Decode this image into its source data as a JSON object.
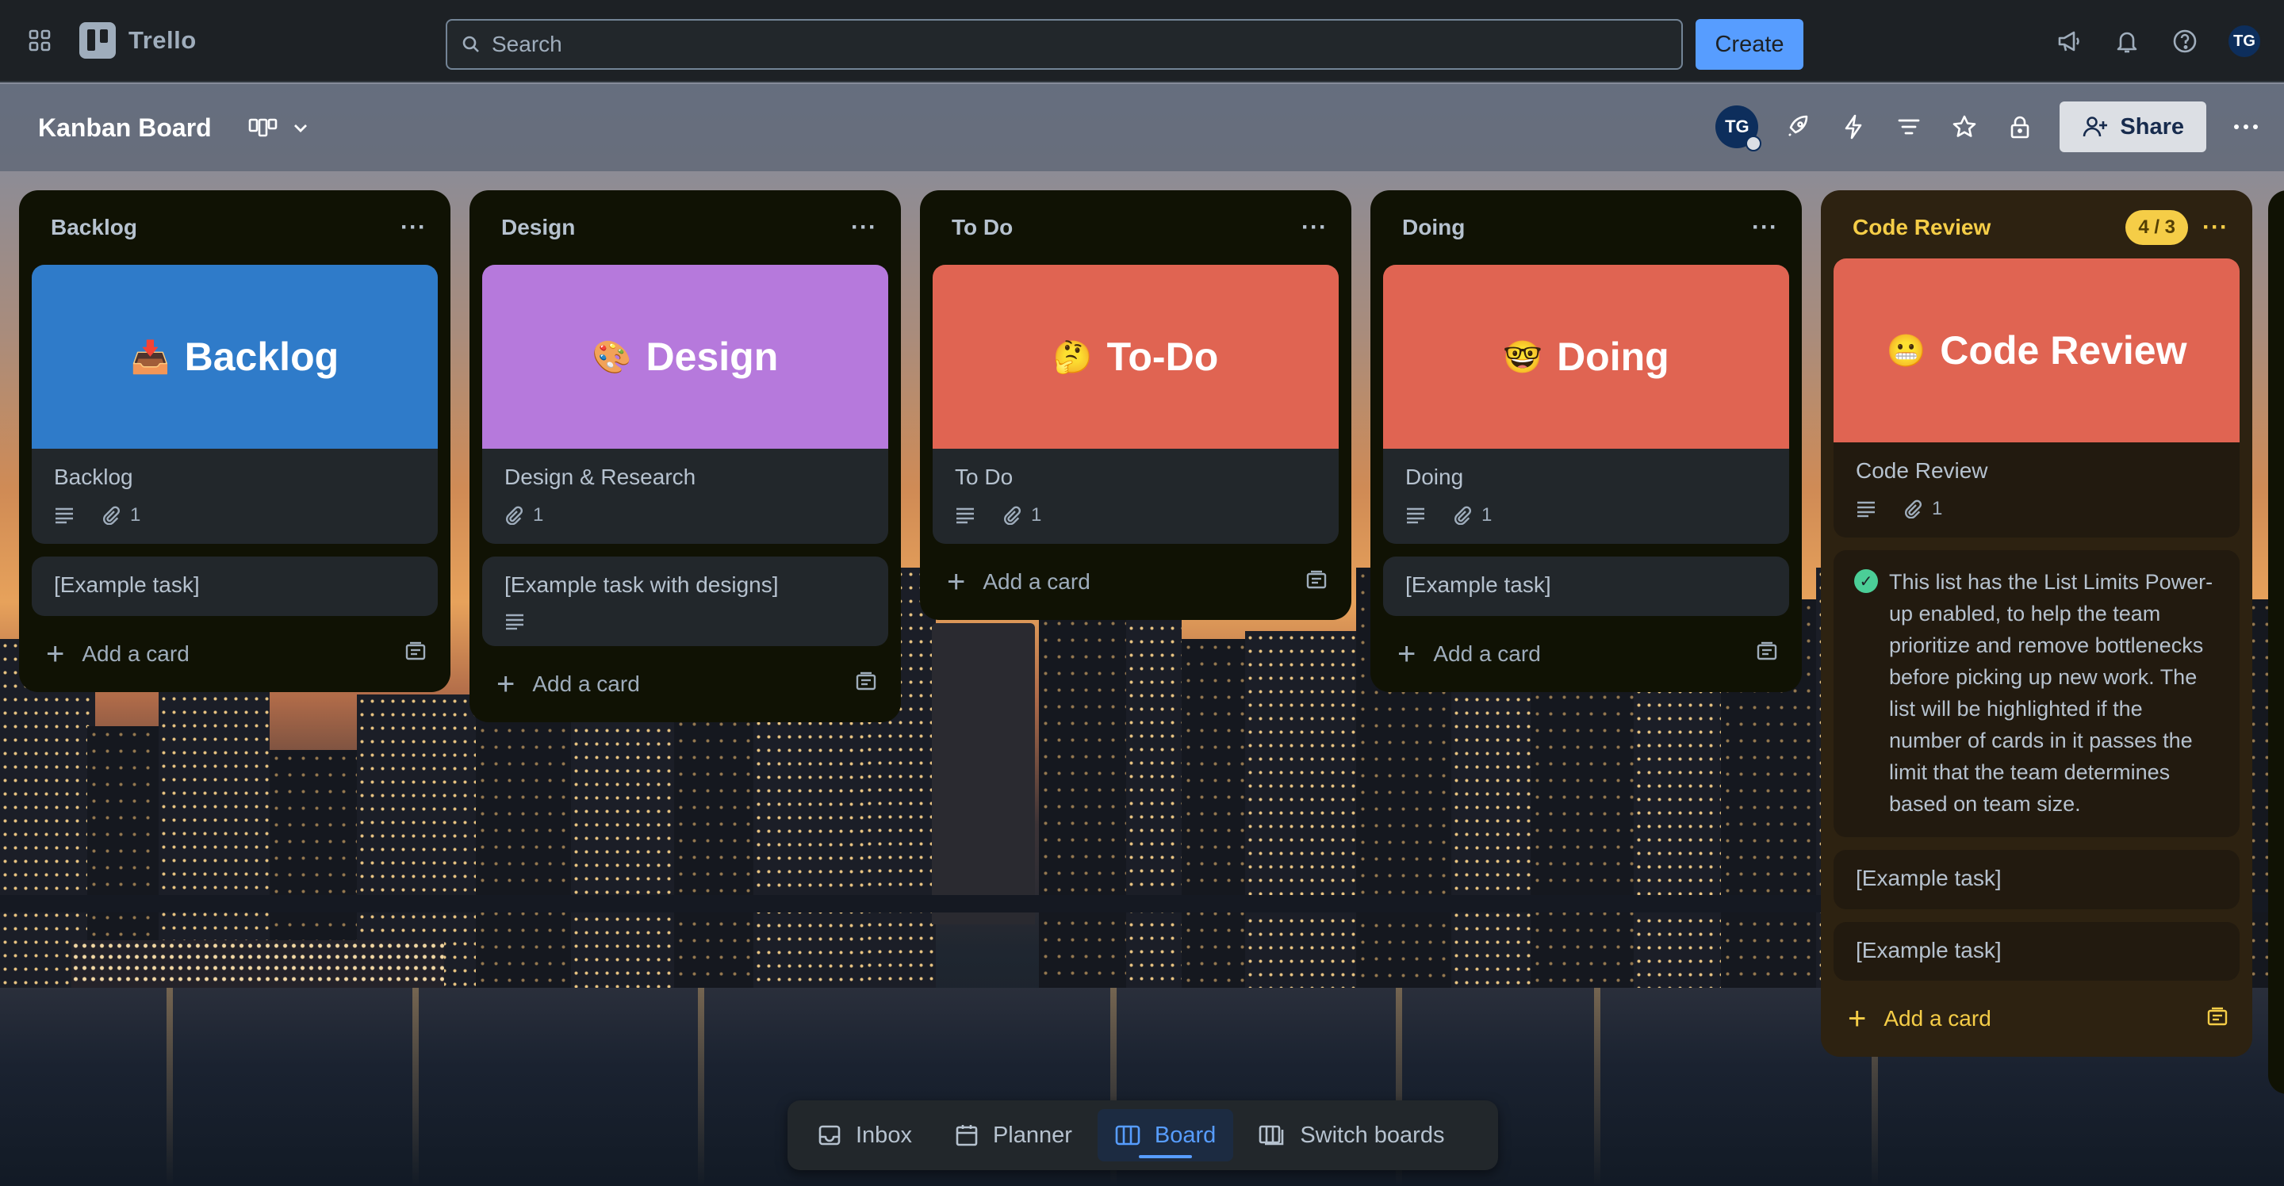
{
  "colors": {
    "accent": "#579dff",
    "backlog_cover": "#2f7bc9",
    "design_cover": "#b679dc",
    "todo_cover": "#e06452",
    "doing_cover": "#e06452",
    "code_review_cover": "#e06452",
    "warning_yellow": "#f5cd47"
  },
  "topnav": {
    "apps_icon": "grid-icon",
    "logo_text": "Trello",
    "search_placeholder": "Search",
    "create_label": "Create",
    "icons": [
      "megaphone-icon",
      "bell-icon",
      "help-icon"
    ],
    "avatar_initials": "TG"
  },
  "board": {
    "title": "Kanban Board",
    "view_icon": "table-view-icon",
    "avatar_initials": "TG",
    "share_label": "Share",
    "toolbar_icons": [
      "rocket-icon",
      "lightning-icon",
      "filter-icon",
      "star-icon",
      "lock-icon",
      "more-icon"
    ]
  },
  "lists": [
    {
      "title": "Backlog",
      "cards": [
        {
          "cover_text": "Backlog",
          "cover_emoji": "📥",
          "title": "Backlog",
          "has_description": true,
          "attachments": "1"
        },
        {
          "title": "[Example task]"
        }
      ],
      "add_label": "Add a card"
    },
    {
      "title": "Design",
      "cards": [
        {
          "cover_text": "Design",
          "cover_emoji": "🎨",
          "title": "Design & Research",
          "attachments": "1"
        },
        {
          "title": "[Example task with designs]",
          "has_description": true
        }
      ],
      "add_label": "Add a card"
    },
    {
      "title": "To Do",
      "cards": [
        {
          "cover_text": "To-Do",
          "cover_emoji": "🤔",
          "title": "To Do",
          "has_description": true,
          "attachments": "1"
        }
      ],
      "add_label": "Add a card"
    },
    {
      "title": "Doing",
      "cards": [
        {
          "cover_text": "Doing",
          "cover_emoji": "🤓",
          "title": "Doing",
          "has_description": true,
          "attachments": "1"
        },
        {
          "title": "[Example task]"
        }
      ],
      "add_label": "Add a card"
    },
    {
      "title": "Code Review",
      "limit_badge": "4 / 3",
      "cards": [
        {
          "cover_text": "Code Review",
          "cover_emoji": "😬",
          "title": "Code Review",
          "has_description": true,
          "attachments": "1"
        },
        {
          "note": "This list has the List Limits Power-up enabled, to help the team prioritize and remove bottlenecks before picking up new work. The list will be highlighted if the number of cards in it passes the limit that the team determines based on team size."
        },
        {
          "title": "[Example task]"
        },
        {
          "title": "[Example task]"
        }
      ],
      "add_label": "Add a card"
    }
  ],
  "switcher": {
    "items": [
      {
        "label": "Inbox",
        "icon": "inbox-icon"
      },
      {
        "label": "Planner",
        "icon": "calendar-icon"
      },
      {
        "label": "Board",
        "icon": "board-icon",
        "active": true
      },
      {
        "label": "Switch boards",
        "icon": "switch-boards-icon"
      }
    ]
  }
}
